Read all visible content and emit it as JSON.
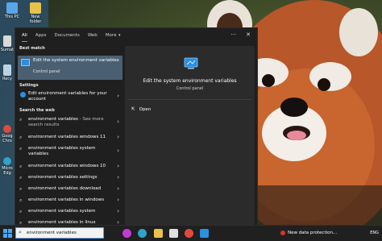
{
  "desktop": {
    "icons": [
      {
        "label": "This PC",
        "icon": "this-pc-icon"
      },
      {
        "label": "New folder",
        "icon": "folder-icon"
      },
      {
        "label": "Sumat",
        "icon": "app-icon"
      },
      {
        "label": "Recy",
        "icon": "recycle-bin-icon"
      },
      {
        "label": "Goog Chro",
        "icon": "chrome-icon"
      },
      {
        "label": "Micro Edg",
        "icon": "edge-icon"
      }
    ]
  },
  "search_panel": {
    "tabs": [
      {
        "label": "All",
        "active": true
      },
      {
        "label": "Apps"
      },
      {
        "label": "Documents"
      },
      {
        "label": "Web"
      },
      {
        "label": "More",
        "has_dropdown": true
      }
    ],
    "controls": {
      "more_options": "···",
      "close": "✕"
    },
    "best_match": {
      "heading": "Best match",
      "title": "Edit the system environment variables",
      "subtitle": "Control panel"
    },
    "settings": {
      "heading": "Settings",
      "item_label": "Edit environment variables for your account"
    },
    "search_web": {
      "heading": "Search the web",
      "items": [
        {
          "label": "environment variables",
          "suffix": " - See more search results"
        },
        {
          "label": "environment variables windows 11"
        },
        {
          "label": "environment variables system variables"
        },
        {
          "label": "environment variables windows 10"
        },
        {
          "label": "environment variables settings"
        },
        {
          "label": "environment variables download"
        },
        {
          "label": "environment variables in windows"
        },
        {
          "label": "environment variables system"
        },
        {
          "label": "environment variables in linux"
        }
      ]
    },
    "preview": {
      "title": "Edit the system environment variables",
      "subtitle": "Control panel",
      "action_open": "Open"
    }
  },
  "taskbar": {
    "search_value": "environment variables",
    "news_text": "New data protection...",
    "tray_text": "ENG"
  },
  "colors": {
    "accent": "#4ea4f5",
    "panel_bg": "#1f1f1f",
    "selected_bg": "#4a6072",
    "taskbar_bg": "#202020"
  }
}
